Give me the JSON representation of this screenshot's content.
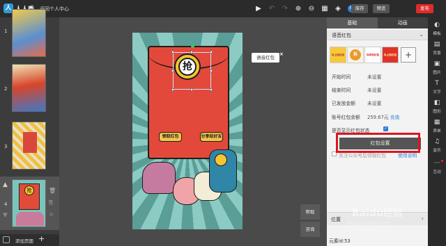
{
  "topbar": {
    "logo_text": "人人秀",
    "back_link": "返回个人中心",
    "save_label": "保存",
    "preview_label": "预览",
    "publish_label": "发布",
    "ps_badge": "Ps"
  },
  "pages": [
    {
      "num": "1"
    },
    {
      "num": "2"
    },
    {
      "num": "3"
    },
    {
      "num": "4"
    }
  ],
  "add_page_label": "添加页面",
  "canvas": {
    "coin_char": "抢",
    "btn_left": "领取红包",
    "btn_right": "分享给好友"
  },
  "tooltip": "语音红包",
  "side_buttons": {
    "help": "帮助",
    "consult": "咨询"
  },
  "panel": {
    "tabs": [
      "基础",
      "动画"
    ],
    "section_title": "语音红包",
    "styles": [
      {
        "text": "马上抢红包"
      },
      {
        "text": "拆"
      },
      {
        "text": "马年抢红包"
      },
      {
        "text": "马上抢红包"
      }
    ],
    "rows": [
      {
        "label": "开始时间",
        "value": "未设置"
      },
      {
        "label": "结束时间",
        "value": "未设置"
      },
      {
        "label": "已发放金额",
        "value": "未设置"
      },
      {
        "label": "账号红包余额",
        "value": "259.67元",
        "link": "充值"
      },
      {
        "label": "是否显示红包状态"
      }
    ],
    "setting_button": "红包设置",
    "follow_label": "关注公众号后领取红包",
    "follow_link": "使用说明",
    "position_label": "位置",
    "element_id": "元素id:53"
  },
  "right_tools": [
    {
      "icon": "palette-icon",
      "label": "模板"
    },
    {
      "icon": "background-icon",
      "label": "背景"
    },
    {
      "icon": "image-icon",
      "label": "图片"
    },
    {
      "icon": "text-icon",
      "label": "文字"
    },
    {
      "icon": "shape-icon",
      "label": "图形"
    },
    {
      "icon": "form-icon",
      "label": "表单"
    },
    {
      "icon": "music-icon",
      "label": "音乐"
    },
    {
      "icon": "interact-icon",
      "label": "互动"
    }
  ],
  "watermark": "Baidu经验",
  "watermark_url": "jingyan.baidu.com",
  "colors": {
    "accent_red": "#e02b2b",
    "highlight_red": "#e0141f",
    "envelope_red": "#e2493b",
    "coin_gold": "#f6c531",
    "link_blue": "#2d86d2"
  }
}
